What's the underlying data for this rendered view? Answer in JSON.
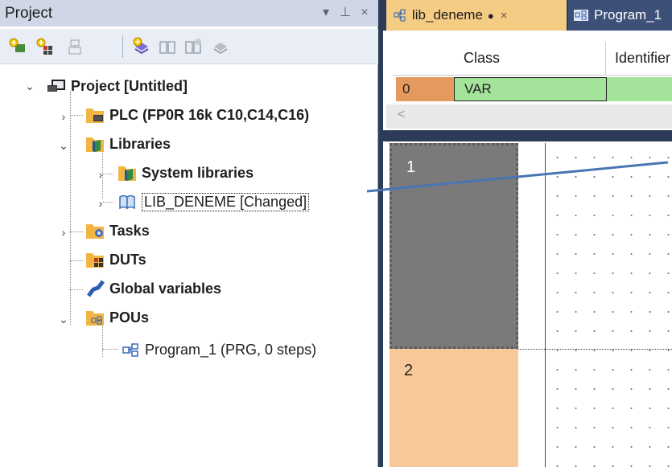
{
  "project_panel": {
    "title": "Project",
    "header_buttons": {
      "dropdown": "▾",
      "pin": "⊥",
      "close": "×"
    },
    "toolbar_icons": [
      "add-plc-icon",
      "add-dut-icon",
      "add-task-icon",
      "add-library-icon",
      "open-library-icon",
      "library-info-icon",
      "remove-library-icon"
    ]
  },
  "tree": {
    "root": "Project [Untitled]",
    "plc": "PLC (FP0R 16k C10,C14,C16)",
    "libraries": "Libraries",
    "system_libraries": "System libraries",
    "lib_deneme": "LIB_DENEME [Changed]",
    "tasks": "Tasks",
    "duts": "DUTs",
    "global_variables": "Global variables",
    "pous": "POUs",
    "program_1": "Program_1 (PRG, 0 steps)"
  },
  "editor": {
    "tabs": [
      {
        "label": "lib_deneme",
        "modified_mark": "●",
        "close": "×",
        "active": true
      },
      {
        "label": "Program_1",
        "active": false
      }
    ],
    "columns": [
      "Class",
      "Identifier"
    ],
    "rows": [
      {
        "index": "0",
        "class": "VAR"
      }
    ],
    "scroll_left_arrow": "<",
    "networks": [
      "1",
      "2"
    ]
  },
  "colors": {
    "dark_chrome": "#2b3b58",
    "active_tab": "#f5cc84",
    "row_index": "#e49a5c",
    "var_cell": "#a3e39a",
    "network_selected": "#7a7a7a",
    "network_unselected": "#f9c89a",
    "annotation_arrow": "#4a74b4"
  }
}
